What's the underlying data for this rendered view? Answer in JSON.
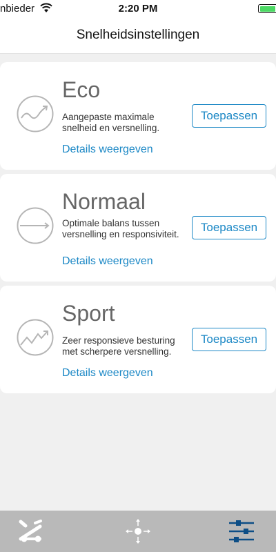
{
  "status_bar": {
    "carrier": "nbieder",
    "time": "2:20 PM",
    "battery_color": "#4cd964"
  },
  "header": {
    "title": "Snelheidsinstellingen"
  },
  "modes": [
    {
      "title": "Eco",
      "description": "Aangepaste maximale snelheid en versnelling.",
      "link": "Details weergeven",
      "button": "Toepassen",
      "icon": "wave-arrow-icon"
    },
    {
      "title": "Normaal",
      "description": "Optimale balans tussen versnelling en responsiviteit.",
      "link": "Details weergeven",
      "button": "Toepassen",
      "icon": "straight-arrow-icon"
    },
    {
      "title": "Sport",
      "description": "Zeer responsieve besturing met scherpere versnelling.",
      "link": "Details weergeven",
      "button": "Toepassen",
      "icon": "zigzag-arrow-icon"
    }
  ],
  "tab_bar": {
    "tabs": [
      "scooter-icon",
      "move-arrows-icon",
      "sliders-icon"
    ]
  },
  "colors": {
    "accent": "#1a87c5",
    "background": "#f0f0f0",
    "tab_bar": "#b9b9b9"
  }
}
